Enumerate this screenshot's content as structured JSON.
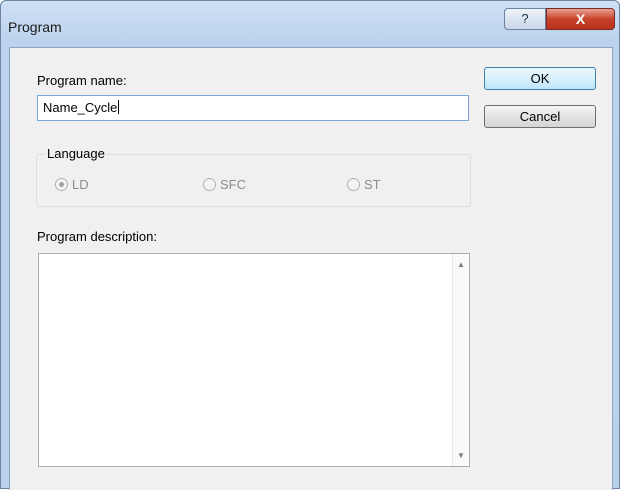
{
  "window": {
    "title": "Program"
  },
  "titlebar": {
    "help_icon": "?",
    "close_icon": "X"
  },
  "form": {
    "name_label": "Program name:",
    "name_value": "Name_Cycle",
    "language_label": "Language",
    "languages": [
      {
        "label": "LD",
        "selected": true,
        "enabled": false
      },
      {
        "label": "SFC",
        "selected": false,
        "enabled": false
      },
      {
        "label": "ST",
        "selected": false,
        "enabled": false
      }
    ],
    "description_label": "Program description:",
    "description_value": ""
  },
  "buttons": {
    "ok": "OK",
    "cancel": "Cancel"
  },
  "icons": {
    "scroll_up": "▲",
    "scroll_down": "▼"
  }
}
